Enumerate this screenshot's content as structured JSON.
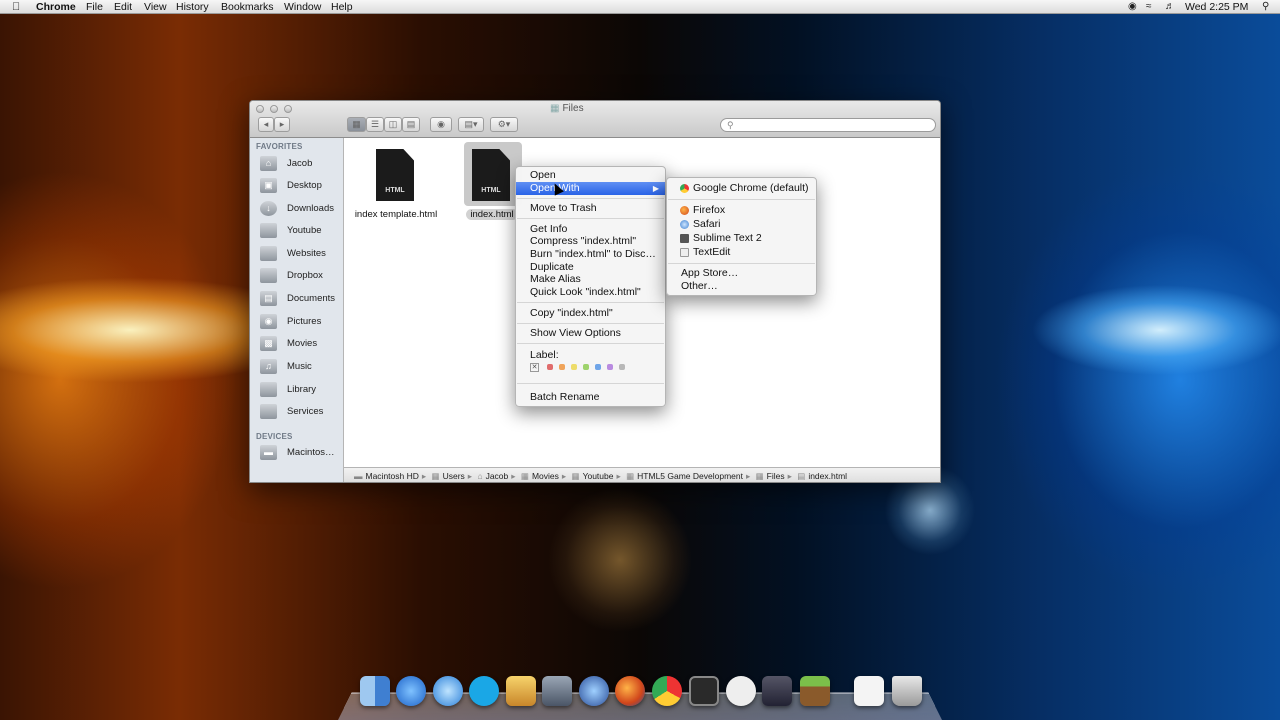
{
  "menubar": {
    "apple": "",
    "app_name": "Chrome",
    "menus": [
      "File",
      "Edit",
      "View",
      "History",
      "Bookmarks",
      "Window",
      "Help"
    ],
    "clock": "Wed 2:25 PM"
  },
  "finder": {
    "title": "Files",
    "sidebar": {
      "favorites_header": "FAVORITES",
      "favorites": [
        "Jacob",
        "Desktop",
        "Downloads",
        "Youtube",
        "Websites",
        "Dropbox",
        "Documents",
        "Pictures",
        "Movies",
        "Music",
        "Library",
        "Services"
      ],
      "devices_header": "DEVICES",
      "devices": [
        "Macintos…"
      ]
    },
    "files": [
      {
        "name": "index template.html",
        "badge": "HTML",
        "selected": false
      },
      {
        "name": "index.html",
        "badge": "HTML",
        "selected": true
      }
    ],
    "path": [
      "Macintosh HD",
      "Users",
      "Jacob",
      "Movies",
      "Youtube",
      "HTML5 Game Development",
      "Files",
      "index.html"
    ]
  },
  "context_menu": {
    "items": [
      "Open",
      "Open With",
      "Move to Trash",
      "Get Info",
      "Compress \"index.html\"",
      "Burn \"index.html\" to Disc…",
      "Duplicate",
      "Make Alias",
      "Quick Look \"index.html\"",
      "Copy \"index.html\"",
      "Show View Options",
      "Label:",
      "Batch Rename"
    ],
    "highlighted": "Open With",
    "label_colors": [
      "#e06c6c",
      "#f0a45a",
      "#eddc6a",
      "#9ed36c",
      "#6fa5e8",
      "#b98be0",
      "#b8b8b8"
    ]
  },
  "submenu": {
    "items": [
      "Google Chrome (default)",
      "Firefox",
      "Safari",
      "Sublime Text 2",
      "TextEdit",
      "App Store…",
      "Other…"
    ]
  }
}
